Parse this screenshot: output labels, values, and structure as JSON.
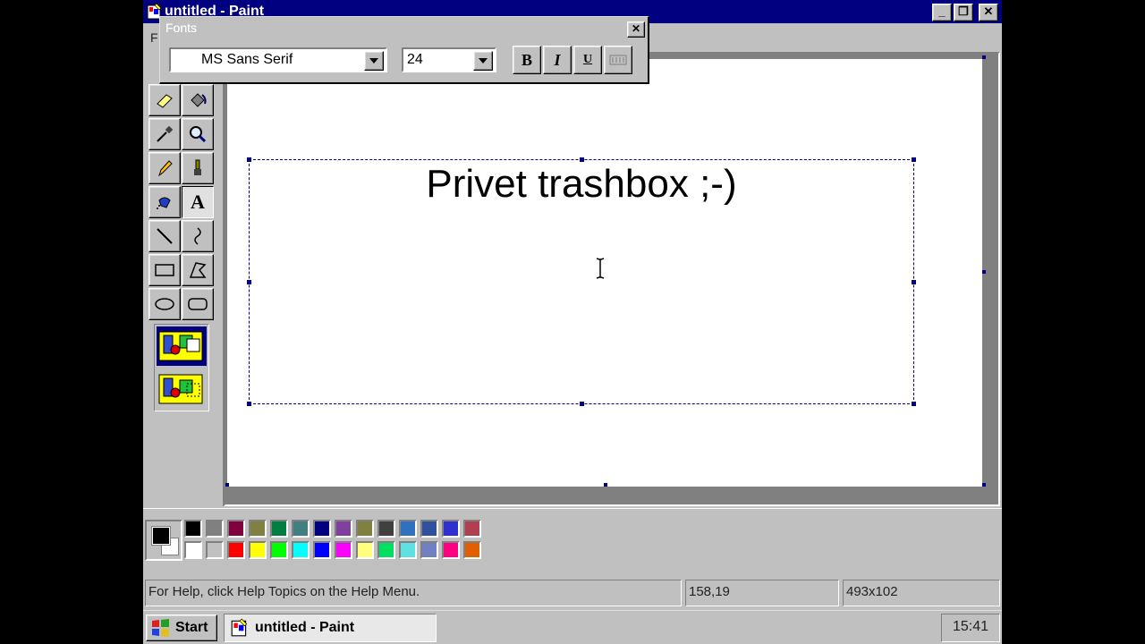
{
  "window": {
    "title": "untitled - Paint",
    "controls": {
      "minimize": "_",
      "maximize": "❐",
      "close": "✕"
    }
  },
  "menu": {
    "visible_label": "F"
  },
  "fonts_toolbar": {
    "title": "Fonts",
    "font_name": "MS Sans Serif",
    "font_size": "24",
    "bold_label": "B",
    "italic_label": "I",
    "underline_label": "U",
    "close_label": "✕"
  },
  "tools": [
    {
      "name": "eraser-tool",
      "icon": "eraser-icon"
    },
    {
      "name": "fill-tool",
      "icon": "fill-bucket-icon"
    },
    {
      "name": "color-picker-tool",
      "icon": "eyedropper-icon"
    },
    {
      "name": "magnifier-tool",
      "icon": "magnifier-icon"
    },
    {
      "name": "pencil-tool",
      "icon": "pencil-icon"
    },
    {
      "name": "brush-tool",
      "icon": "brush-icon"
    },
    {
      "name": "airbrush-tool",
      "icon": "airbrush-icon"
    },
    {
      "name": "text-tool",
      "icon": "text-icon",
      "label": "A",
      "active": true
    },
    {
      "name": "line-tool",
      "icon": "line-icon"
    },
    {
      "name": "curve-tool",
      "icon": "curve-icon"
    },
    {
      "name": "rectangle-tool",
      "icon": "rectangle-icon"
    },
    {
      "name": "polygon-tool",
      "icon": "polygon-icon"
    },
    {
      "name": "ellipse-tool",
      "icon": "ellipse-icon"
    },
    {
      "name": "rounded-rectangle-tool",
      "icon": "rounded-rectangle-icon"
    }
  ],
  "canvas": {
    "text": "Privet trashbox ;-)"
  },
  "palette": {
    "foreground": "#000000",
    "background": "#ffffff",
    "top_row": [
      "#000000",
      "#808080",
      "#800040",
      "#808040",
      "#008040",
      "#408080",
      "#000080",
      "#8040a0",
      "#808040",
      "#404040",
      "#3070c0",
      "#3050a0",
      "#3030d0",
      "#b04050"
    ],
    "bottom_row": [
      "#ffffff",
      "#c0c0c0",
      "#ff0000",
      "#ffff00",
      "#00ff00",
      "#00ffff",
      "#0000ff",
      "#ff00ff",
      "#ffff80",
      "#00e060",
      "#60e0e0",
      "#7080c0",
      "#ff0080",
      "#e06000"
    ]
  },
  "status": {
    "help": "For Help, click Help Topics on the Help Menu.",
    "coords": "158,19",
    "size": "493x102"
  },
  "taskbar": {
    "start_label": "Start",
    "task_label": "untitled - Paint",
    "clock": "15:41"
  }
}
